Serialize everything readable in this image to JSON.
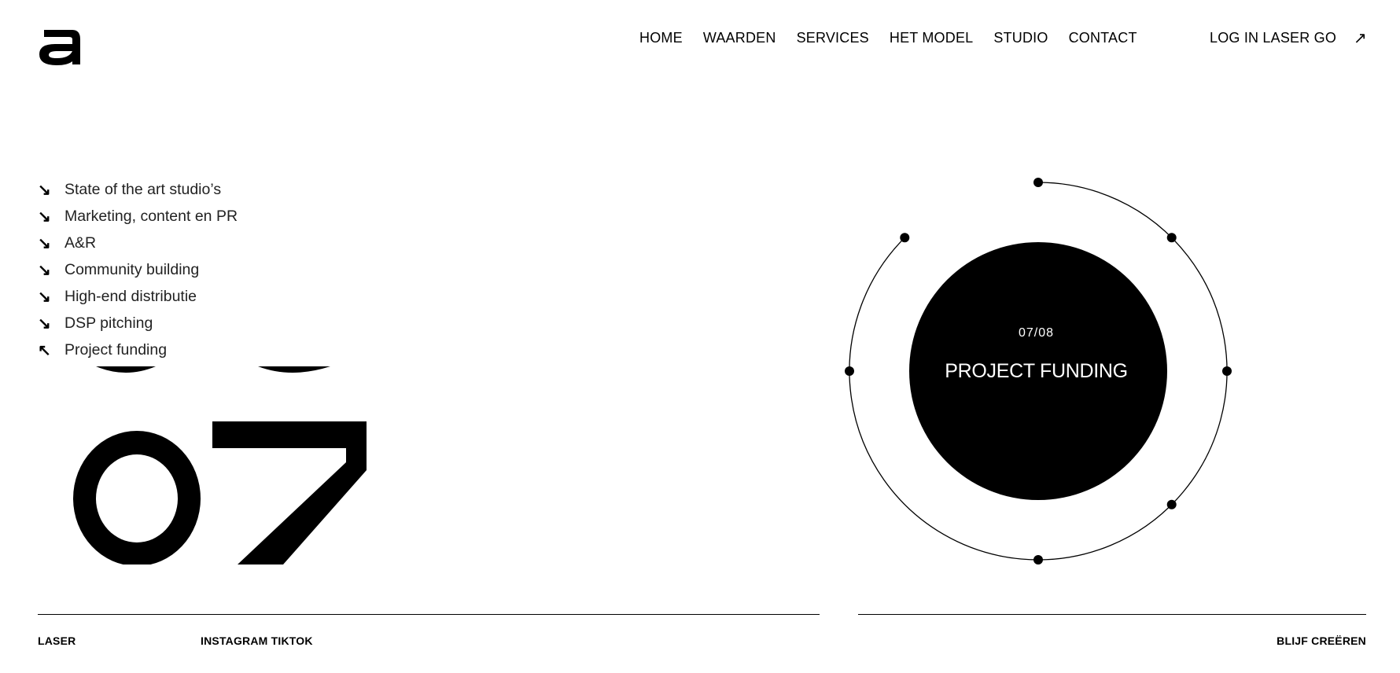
{
  "logo": {
    "icon": "a-logo"
  },
  "nav": {
    "items": [
      {
        "label": "HOME",
        "name": "nav-home"
      },
      {
        "label": "WAARDEN",
        "name": "nav-waarden"
      },
      {
        "label": "SERVICES",
        "name": "nav-services"
      },
      {
        "label": "HET MODEL",
        "name": "nav-het-model"
      },
      {
        "label": "STUDIO",
        "name": "nav-studio"
      },
      {
        "label": "CONTACT",
        "name": "nav-contact"
      }
    ],
    "login_label": "LOG IN LASER GO",
    "login_icon": "arrow-up-right-icon"
  },
  "services": {
    "items": [
      {
        "label": "State of the art studio’s",
        "icon": "↘"
      },
      {
        "label": "Marketing, content en PR",
        "icon": "↘"
      },
      {
        "label": "A&R",
        "icon": "↘"
      },
      {
        "label": "Community building",
        "icon": "↘"
      },
      {
        "label": "High-end distributie",
        "icon": "↘"
      },
      {
        "label": "DSP pitching",
        "icon": "↘"
      },
      {
        "label": "Project funding",
        "icon": "↖"
      }
    ]
  },
  "feature": {
    "number": "07",
    "counter": "07/08",
    "title": "PROJECT FUNDING",
    "progress": 0.875
  },
  "footer": {
    "laser": "LASER",
    "social": "INSTAGRAM TIKTOK",
    "cta": "BLIJF CREËREN"
  },
  "colors": {
    "background": "#ffffff",
    "foreground": "#000000"
  }
}
